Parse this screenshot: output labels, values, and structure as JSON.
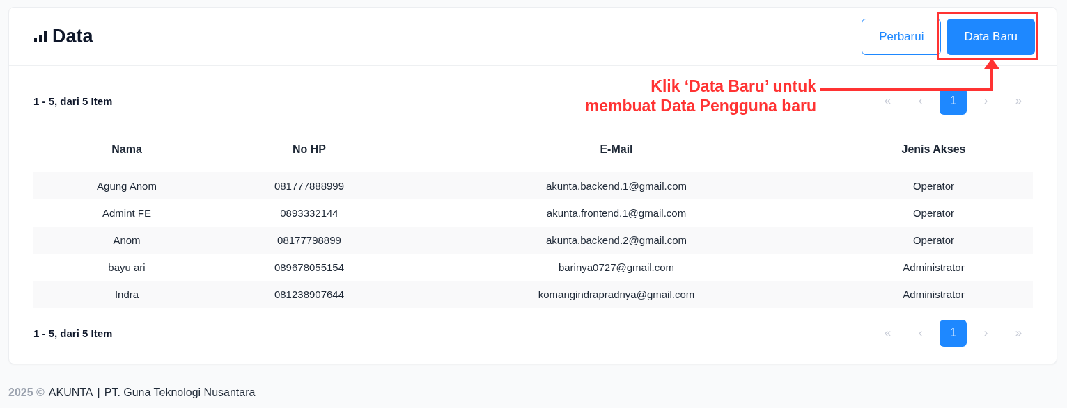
{
  "card": {
    "title": "Data",
    "buttons": [
      {
        "label": "Perbarui",
        "kind": "outline"
      },
      {
        "label": "Data Baru",
        "kind": "primary"
      }
    ]
  },
  "pagination_top": {
    "summary": "1 - 5, dari 5 Item",
    "pages": [
      {
        "label": "«",
        "disabled": true,
        "selected": false
      },
      {
        "label": "‹",
        "disabled": true,
        "selected": false
      },
      {
        "label": "1",
        "disabled": false,
        "selected": true
      },
      {
        "label": "›",
        "disabled": true,
        "selected": false
      },
      {
        "label": "»",
        "disabled": true,
        "selected": false
      }
    ]
  },
  "table": {
    "columns": [
      "Nama",
      "No HP",
      "E-Mail",
      "Jenis Akses"
    ],
    "rows": [
      [
        "Agung Anom",
        "081777888999",
        "akunta.backend.1@gmail.com",
        "Operator"
      ],
      [
        "Admint FE",
        "0893332144",
        "akunta.frontend.1@gmail.com",
        "Operator"
      ],
      [
        "Anom",
        "08177798899",
        "akunta.backend.2@gmail.com",
        "Operator"
      ],
      [
        "bayu ari",
        "089678055154",
        "barinya0727@gmail.com",
        "Administrator"
      ],
      [
        "Indra",
        "081238907644",
        "komangindrapradnya@gmail.com",
        "Administrator"
      ]
    ]
  },
  "pagination_bottom": {
    "summary": "1 - 5, dari 5 Item",
    "pages": [
      {
        "label": "«",
        "disabled": true,
        "selected": false
      },
      {
        "label": "‹",
        "disabled": true,
        "selected": false
      },
      {
        "label": "1",
        "disabled": false,
        "selected": true
      },
      {
        "label": "›",
        "disabled": true,
        "selected": false
      },
      {
        "label": "»",
        "disabled": true,
        "selected": false
      }
    ]
  },
  "annotation": {
    "lines": [
      "Klik ‘Data Baru’ untuk",
      "membuat Data Pengguna baru"
    ]
  },
  "footer": {
    "year": "2025 ©",
    "brand": "AKUNTA",
    "separator": "|",
    "company": "PT. Guna Teknologi Nusantara"
  }
}
